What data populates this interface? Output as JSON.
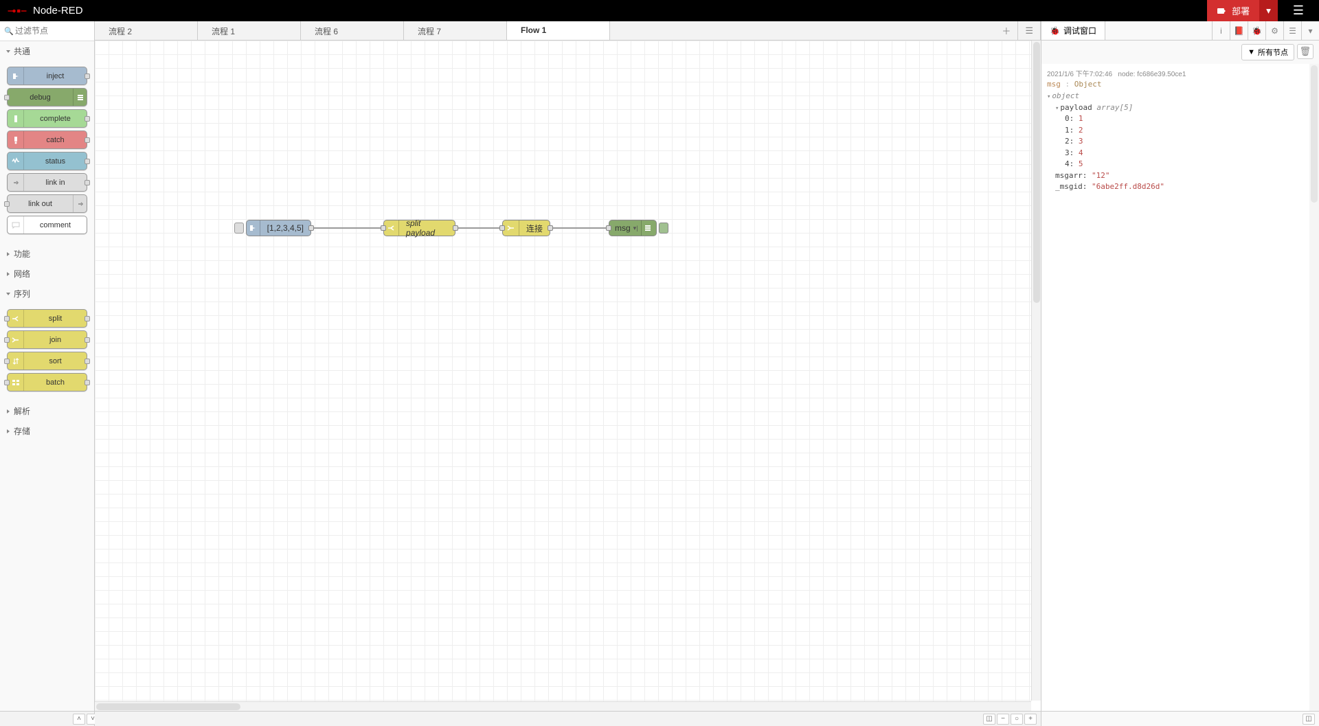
{
  "header": {
    "app_name": "Node-RED",
    "deploy_label": "部署"
  },
  "palette": {
    "search_placeholder": "过滤节点",
    "categories": {
      "common": {
        "label": "共通",
        "nodes": {
          "inject": "inject",
          "debug": "debug",
          "complete": "complete",
          "catch": "catch",
          "status": "status",
          "link_in": "link in",
          "link_out": "link out",
          "comment": "comment"
        }
      },
      "function": {
        "label": "功能"
      },
      "network": {
        "label": "网络"
      },
      "sequence": {
        "label": "序列",
        "nodes": {
          "split": "split",
          "join": "join",
          "sort": "sort",
          "batch": "batch"
        }
      },
      "parser": {
        "label": "解析"
      },
      "storage": {
        "label": "存储"
      }
    }
  },
  "tabs": {
    "t0": "流程 2",
    "t1": "流程 1",
    "t2": "流程 6",
    "t3": "流程 7",
    "t4": "Flow 1"
  },
  "canvas_nodes": {
    "inject": "[1,2,3,4,5]",
    "split": "split payload",
    "join": "连接",
    "debug": "msg"
  },
  "sidebar": {
    "title": "调试窗口",
    "filter_label": "所有节点",
    "debug_entry": {
      "timestamp": "2021/1/6 下午7:02:46",
      "node_label": "node:",
      "node_id": "fc686e39.50ce1",
      "msg_key": "msg",
      "msg_type": "Object",
      "object_label": "object",
      "payload_key": "payload",
      "payload_type": "array[5]",
      "items": {
        "k0": "0:",
        "v0": "1",
        "k1": "1:",
        "v1": "2",
        "k2": "2:",
        "v2": "3",
        "k3": "3:",
        "v3": "4",
        "k4": "4:",
        "v4": "5"
      },
      "msgarr_key": "msgarr:",
      "msgarr_val": "\"12\"",
      "msgid_key": "_msgid:",
      "msgid_val": "\"6abe2ff.d8d26d\""
    }
  }
}
